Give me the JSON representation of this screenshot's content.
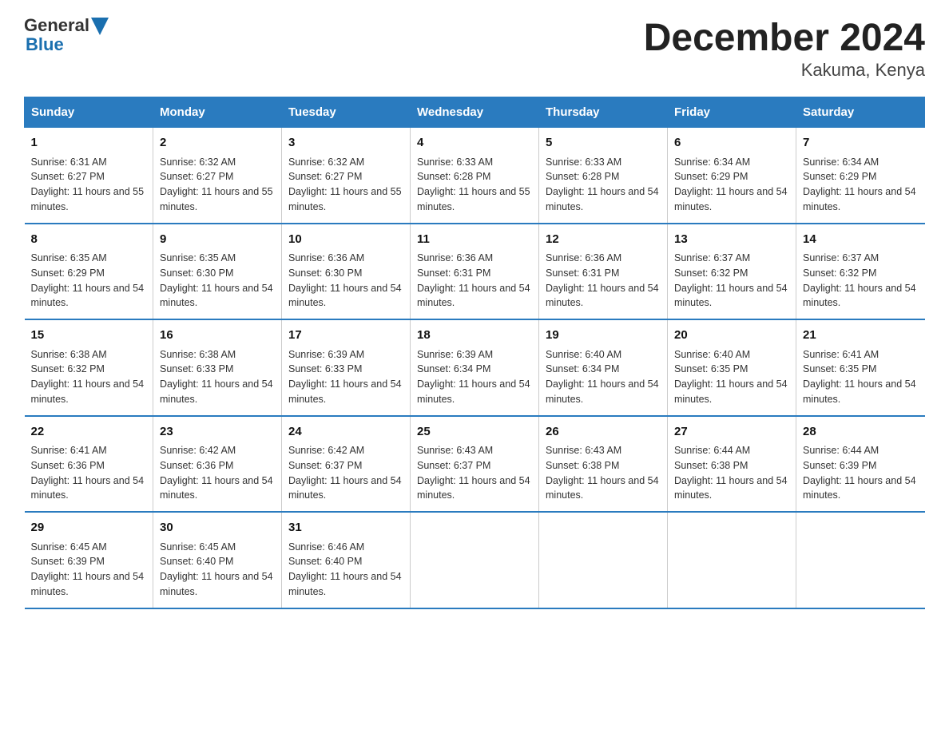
{
  "logo": {
    "general": "General",
    "blue": "Blue"
  },
  "title": "December 2024",
  "subtitle": "Kakuma, Kenya",
  "days_header": [
    "Sunday",
    "Monday",
    "Tuesday",
    "Wednesday",
    "Thursday",
    "Friday",
    "Saturday"
  ],
  "weeks": [
    [
      {
        "day": "1",
        "sunrise": "6:31 AM",
        "sunset": "6:27 PM",
        "daylight": "11 hours and 55 minutes."
      },
      {
        "day": "2",
        "sunrise": "6:32 AM",
        "sunset": "6:27 PM",
        "daylight": "11 hours and 55 minutes."
      },
      {
        "day": "3",
        "sunrise": "6:32 AM",
        "sunset": "6:27 PM",
        "daylight": "11 hours and 55 minutes."
      },
      {
        "day": "4",
        "sunrise": "6:33 AM",
        "sunset": "6:28 PM",
        "daylight": "11 hours and 55 minutes."
      },
      {
        "day": "5",
        "sunrise": "6:33 AM",
        "sunset": "6:28 PM",
        "daylight": "11 hours and 54 minutes."
      },
      {
        "day": "6",
        "sunrise": "6:34 AM",
        "sunset": "6:29 PM",
        "daylight": "11 hours and 54 minutes."
      },
      {
        "day": "7",
        "sunrise": "6:34 AM",
        "sunset": "6:29 PM",
        "daylight": "11 hours and 54 minutes."
      }
    ],
    [
      {
        "day": "8",
        "sunrise": "6:35 AM",
        "sunset": "6:29 PM",
        "daylight": "11 hours and 54 minutes."
      },
      {
        "day": "9",
        "sunrise": "6:35 AM",
        "sunset": "6:30 PM",
        "daylight": "11 hours and 54 minutes."
      },
      {
        "day": "10",
        "sunrise": "6:36 AM",
        "sunset": "6:30 PM",
        "daylight": "11 hours and 54 minutes."
      },
      {
        "day": "11",
        "sunrise": "6:36 AM",
        "sunset": "6:31 PM",
        "daylight": "11 hours and 54 minutes."
      },
      {
        "day": "12",
        "sunrise": "6:36 AM",
        "sunset": "6:31 PM",
        "daylight": "11 hours and 54 minutes."
      },
      {
        "day": "13",
        "sunrise": "6:37 AM",
        "sunset": "6:32 PM",
        "daylight": "11 hours and 54 minutes."
      },
      {
        "day": "14",
        "sunrise": "6:37 AM",
        "sunset": "6:32 PM",
        "daylight": "11 hours and 54 minutes."
      }
    ],
    [
      {
        "day": "15",
        "sunrise": "6:38 AM",
        "sunset": "6:32 PM",
        "daylight": "11 hours and 54 minutes."
      },
      {
        "day": "16",
        "sunrise": "6:38 AM",
        "sunset": "6:33 PM",
        "daylight": "11 hours and 54 minutes."
      },
      {
        "day": "17",
        "sunrise": "6:39 AM",
        "sunset": "6:33 PM",
        "daylight": "11 hours and 54 minutes."
      },
      {
        "day": "18",
        "sunrise": "6:39 AM",
        "sunset": "6:34 PM",
        "daylight": "11 hours and 54 minutes."
      },
      {
        "day": "19",
        "sunrise": "6:40 AM",
        "sunset": "6:34 PM",
        "daylight": "11 hours and 54 minutes."
      },
      {
        "day": "20",
        "sunrise": "6:40 AM",
        "sunset": "6:35 PM",
        "daylight": "11 hours and 54 minutes."
      },
      {
        "day": "21",
        "sunrise": "6:41 AM",
        "sunset": "6:35 PM",
        "daylight": "11 hours and 54 minutes."
      }
    ],
    [
      {
        "day": "22",
        "sunrise": "6:41 AM",
        "sunset": "6:36 PM",
        "daylight": "11 hours and 54 minutes."
      },
      {
        "day": "23",
        "sunrise": "6:42 AM",
        "sunset": "6:36 PM",
        "daylight": "11 hours and 54 minutes."
      },
      {
        "day": "24",
        "sunrise": "6:42 AM",
        "sunset": "6:37 PM",
        "daylight": "11 hours and 54 minutes."
      },
      {
        "day": "25",
        "sunrise": "6:43 AM",
        "sunset": "6:37 PM",
        "daylight": "11 hours and 54 minutes."
      },
      {
        "day": "26",
        "sunrise": "6:43 AM",
        "sunset": "6:38 PM",
        "daylight": "11 hours and 54 minutes."
      },
      {
        "day": "27",
        "sunrise": "6:44 AM",
        "sunset": "6:38 PM",
        "daylight": "11 hours and 54 minutes."
      },
      {
        "day": "28",
        "sunrise": "6:44 AM",
        "sunset": "6:39 PM",
        "daylight": "11 hours and 54 minutes."
      }
    ],
    [
      {
        "day": "29",
        "sunrise": "6:45 AM",
        "sunset": "6:39 PM",
        "daylight": "11 hours and 54 minutes."
      },
      {
        "day": "30",
        "sunrise": "6:45 AM",
        "sunset": "6:40 PM",
        "daylight": "11 hours and 54 minutes."
      },
      {
        "day": "31",
        "sunrise": "6:46 AM",
        "sunset": "6:40 PM",
        "daylight": "11 hours and 54 minutes."
      },
      {
        "day": "",
        "sunrise": "",
        "sunset": "",
        "daylight": ""
      },
      {
        "day": "",
        "sunrise": "",
        "sunset": "",
        "daylight": ""
      },
      {
        "day": "",
        "sunrise": "",
        "sunset": "",
        "daylight": ""
      },
      {
        "day": "",
        "sunrise": "",
        "sunset": "",
        "daylight": ""
      }
    ]
  ]
}
